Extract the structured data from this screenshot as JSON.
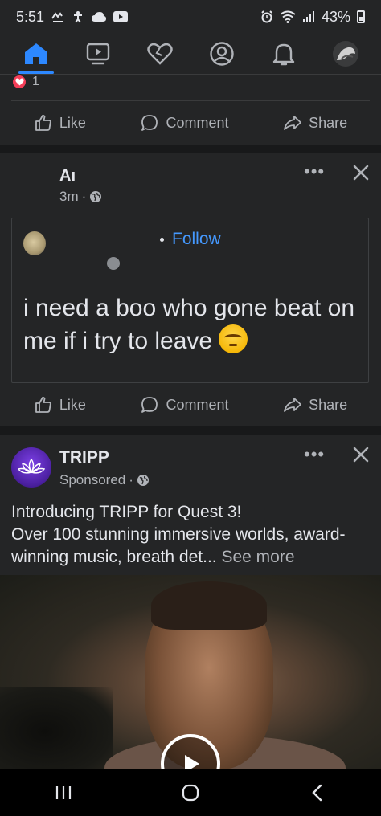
{
  "status_bar": {
    "time": "5:51",
    "battery": "43%",
    "left_icons": [
      "missed-call-icon",
      "accessibility-icon",
      "cloud-icon",
      "youtube-icon"
    ],
    "right_icons": [
      "alarm-icon",
      "wifi-icon",
      "signal-icon",
      "battery-icon"
    ]
  },
  "nav": {
    "items": [
      {
        "name": "home",
        "icon": "home-icon",
        "active": true
      },
      {
        "name": "watch",
        "icon": "video-icon",
        "active": false
      },
      {
        "name": "dating",
        "icon": "heart-icon",
        "active": false
      },
      {
        "name": "profile",
        "icon": "profile-icon",
        "active": false
      },
      {
        "name": "notifications",
        "icon": "bell-icon",
        "active": false
      },
      {
        "name": "menu",
        "icon": "avatar-icon",
        "active": false
      }
    ]
  },
  "post1": {
    "reaction_count": "1",
    "actions": {
      "like": "Like",
      "comment": "Comment",
      "share": "Share"
    }
  },
  "post2": {
    "author": "Aı",
    "time": "3m",
    "more": "•••",
    "shared": {
      "follow_separator": "•",
      "follow_label": "Follow",
      "text": "i need a boo who gone beat on me if i try to leave"
    },
    "actions": {
      "like": "Like",
      "comment": "Comment",
      "share": "Share"
    }
  },
  "ad": {
    "name": "TRIPP",
    "sponsored": "Sponsored",
    "more": "•••",
    "line1": "Introducing TRIPP for Quest 3!",
    "line2": "Over 100 stunning immersive worlds, award-winning music, breath det...",
    "see_more": "See more"
  },
  "colors": {
    "background": "#242526",
    "separator": "#18191a",
    "accent": "#2d88ff",
    "link": "#4599ff",
    "text": "#e4e6eb",
    "muted": "#b0b3b8"
  }
}
